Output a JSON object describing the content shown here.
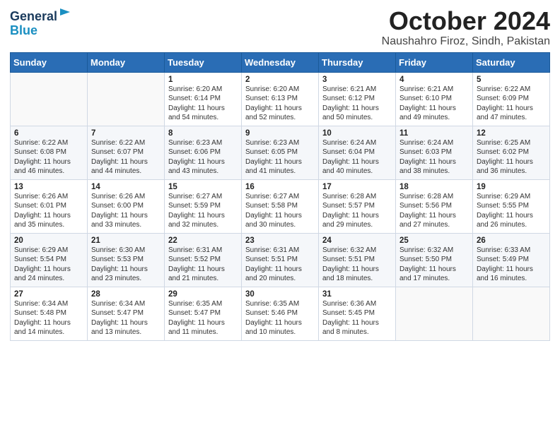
{
  "logo": {
    "line1": "General",
    "line2": "Blue"
  },
  "title": "October 2024",
  "subtitle": "Naushahro Firoz, Sindh, Pakistan",
  "days_of_week": [
    "Sunday",
    "Monday",
    "Tuesday",
    "Wednesday",
    "Thursday",
    "Friday",
    "Saturday"
  ],
  "weeks": [
    [
      {
        "day": "",
        "sunrise": "",
        "sunset": "",
        "daylight": ""
      },
      {
        "day": "",
        "sunrise": "",
        "sunset": "",
        "daylight": ""
      },
      {
        "day": "1",
        "sunrise": "Sunrise: 6:20 AM",
        "sunset": "Sunset: 6:14 PM",
        "daylight": "Daylight: 11 hours and 54 minutes."
      },
      {
        "day": "2",
        "sunrise": "Sunrise: 6:20 AM",
        "sunset": "Sunset: 6:13 PM",
        "daylight": "Daylight: 11 hours and 52 minutes."
      },
      {
        "day": "3",
        "sunrise": "Sunrise: 6:21 AM",
        "sunset": "Sunset: 6:12 PM",
        "daylight": "Daylight: 11 hours and 50 minutes."
      },
      {
        "day": "4",
        "sunrise": "Sunrise: 6:21 AM",
        "sunset": "Sunset: 6:10 PM",
        "daylight": "Daylight: 11 hours and 49 minutes."
      },
      {
        "day": "5",
        "sunrise": "Sunrise: 6:22 AM",
        "sunset": "Sunset: 6:09 PM",
        "daylight": "Daylight: 11 hours and 47 minutes."
      }
    ],
    [
      {
        "day": "6",
        "sunrise": "Sunrise: 6:22 AM",
        "sunset": "Sunset: 6:08 PM",
        "daylight": "Daylight: 11 hours and 46 minutes."
      },
      {
        "day": "7",
        "sunrise": "Sunrise: 6:22 AM",
        "sunset": "Sunset: 6:07 PM",
        "daylight": "Daylight: 11 hours and 44 minutes."
      },
      {
        "day": "8",
        "sunrise": "Sunrise: 6:23 AM",
        "sunset": "Sunset: 6:06 PM",
        "daylight": "Daylight: 11 hours and 43 minutes."
      },
      {
        "day": "9",
        "sunrise": "Sunrise: 6:23 AM",
        "sunset": "Sunset: 6:05 PM",
        "daylight": "Daylight: 11 hours and 41 minutes."
      },
      {
        "day": "10",
        "sunrise": "Sunrise: 6:24 AM",
        "sunset": "Sunset: 6:04 PM",
        "daylight": "Daylight: 11 hours and 40 minutes."
      },
      {
        "day": "11",
        "sunrise": "Sunrise: 6:24 AM",
        "sunset": "Sunset: 6:03 PM",
        "daylight": "Daylight: 11 hours and 38 minutes."
      },
      {
        "day": "12",
        "sunrise": "Sunrise: 6:25 AM",
        "sunset": "Sunset: 6:02 PM",
        "daylight": "Daylight: 11 hours and 36 minutes."
      }
    ],
    [
      {
        "day": "13",
        "sunrise": "Sunrise: 6:26 AM",
        "sunset": "Sunset: 6:01 PM",
        "daylight": "Daylight: 11 hours and 35 minutes."
      },
      {
        "day": "14",
        "sunrise": "Sunrise: 6:26 AM",
        "sunset": "Sunset: 6:00 PM",
        "daylight": "Daylight: 11 hours and 33 minutes."
      },
      {
        "day": "15",
        "sunrise": "Sunrise: 6:27 AM",
        "sunset": "Sunset: 5:59 PM",
        "daylight": "Daylight: 11 hours and 32 minutes."
      },
      {
        "day": "16",
        "sunrise": "Sunrise: 6:27 AM",
        "sunset": "Sunset: 5:58 PM",
        "daylight": "Daylight: 11 hours and 30 minutes."
      },
      {
        "day": "17",
        "sunrise": "Sunrise: 6:28 AM",
        "sunset": "Sunset: 5:57 PM",
        "daylight": "Daylight: 11 hours and 29 minutes."
      },
      {
        "day": "18",
        "sunrise": "Sunrise: 6:28 AM",
        "sunset": "Sunset: 5:56 PM",
        "daylight": "Daylight: 11 hours and 27 minutes."
      },
      {
        "day": "19",
        "sunrise": "Sunrise: 6:29 AM",
        "sunset": "Sunset: 5:55 PM",
        "daylight": "Daylight: 11 hours and 26 minutes."
      }
    ],
    [
      {
        "day": "20",
        "sunrise": "Sunrise: 6:29 AM",
        "sunset": "Sunset: 5:54 PM",
        "daylight": "Daylight: 11 hours and 24 minutes."
      },
      {
        "day": "21",
        "sunrise": "Sunrise: 6:30 AM",
        "sunset": "Sunset: 5:53 PM",
        "daylight": "Daylight: 11 hours and 23 minutes."
      },
      {
        "day": "22",
        "sunrise": "Sunrise: 6:31 AM",
        "sunset": "Sunset: 5:52 PM",
        "daylight": "Daylight: 11 hours and 21 minutes."
      },
      {
        "day": "23",
        "sunrise": "Sunrise: 6:31 AM",
        "sunset": "Sunset: 5:51 PM",
        "daylight": "Daylight: 11 hours and 20 minutes."
      },
      {
        "day": "24",
        "sunrise": "Sunrise: 6:32 AM",
        "sunset": "Sunset: 5:51 PM",
        "daylight": "Daylight: 11 hours and 18 minutes."
      },
      {
        "day": "25",
        "sunrise": "Sunrise: 6:32 AM",
        "sunset": "Sunset: 5:50 PM",
        "daylight": "Daylight: 11 hours and 17 minutes."
      },
      {
        "day": "26",
        "sunrise": "Sunrise: 6:33 AM",
        "sunset": "Sunset: 5:49 PM",
        "daylight": "Daylight: 11 hours and 16 minutes."
      }
    ],
    [
      {
        "day": "27",
        "sunrise": "Sunrise: 6:34 AM",
        "sunset": "Sunset: 5:48 PM",
        "daylight": "Daylight: 11 hours and 14 minutes."
      },
      {
        "day": "28",
        "sunrise": "Sunrise: 6:34 AM",
        "sunset": "Sunset: 5:47 PM",
        "daylight": "Daylight: 11 hours and 13 minutes."
      },
      {
        "day": "29",
        "sunrise": "Sunrise: 6:35 AM",
        "sunset": "Sunset: 5:47 PM",
        "daylight": "Daylight: 11 hours and 11 minutes."
      },
      {
        "day": "30",
        "sunrise": "Sunrise: 6:35 AM",
        "sunset": "Sunset: 5:46 PM",
        "daylight": "Daylight: 11 hours and 10 minutes."
      },
      {
        "day": "31",
        "sunrise": "Sunrise: 6:36 AM",
        "sunset": "Sunset: 5:45 PM",
        "daylight": "Daylight: 11 hours and 8 minutes."
      },
      {
        "day": "",
        "sunrise": "",
        "sunset": "",
        "daylight": ""
      },
      {
        "day": "",
        "sunrise": "",
        "sunset": "",
        "daylight": ""
      }
    ]
  ]
}
